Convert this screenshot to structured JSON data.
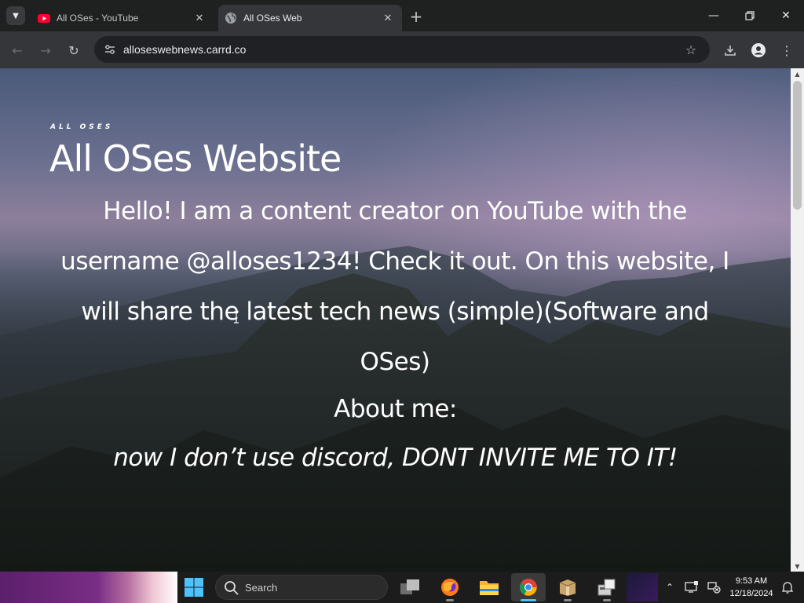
{
  "browser": {
    "tabs": [
      {
        "title": "All OSes - YouTube",
        "active": false,
        "favicon": "youtube-icon"
      },
      {
        "title": "All OSes Web",
        "active": true,
        "favicon": "globe-icon"
      }
    ],
    "address": "alloseswebnews.carrd.co"
  },
  "page": {
    "mini_title": "ALL OSES",
    "title": "All OSes Website",
    "intro": "Hello! I am a content creator on YouTube with the username @alloses1234! Check it out. On this website, I will share the latest tech news (simple)(Software and OSes)",
    "about_heading": "About me:",
    "note": "now I don’t use discord, DONT INVITE ME TO IT!"
  },
  "taskbar": {
    "search_label": "Search",
    "time": "9:53 AM",
    "date": "12/18/2024"
  },
  "colors": {
    "youtube_red": "#ff0033",
    "active_indicator": "#4cc2ff",
    "page_text": "#ffffff"
  }
}
